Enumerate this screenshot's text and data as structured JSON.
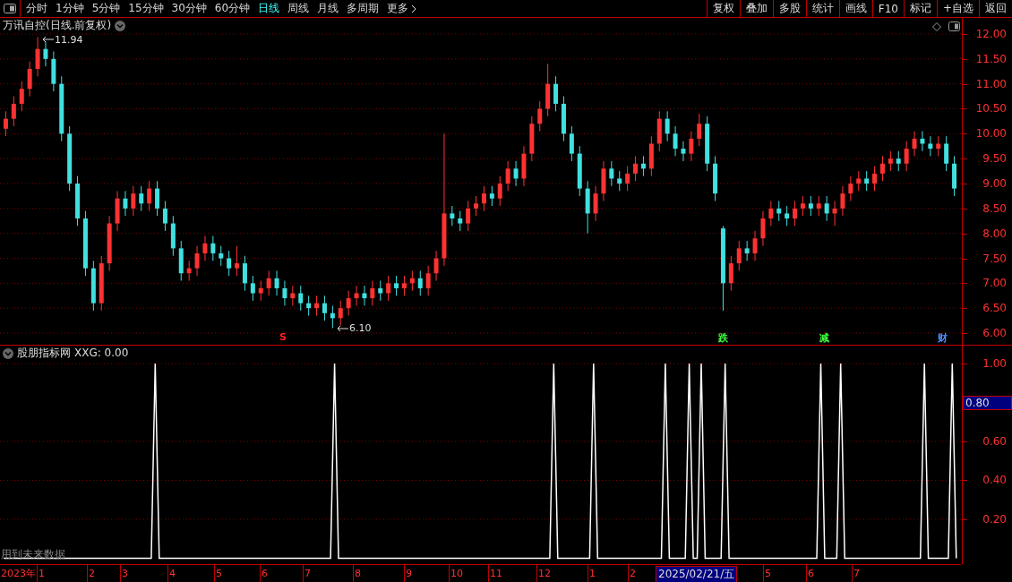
{
  "toolbar": {
    "periods": [
      {
        "label": "分时",
        "selected": false
      },
      {
        "label": "1分钟",
        "selected": false
      },
      {
        "label": "5分钟",
        "selected": false
      },
      {
        "label": "15分钟",
        "selected": false
      },
      {
        "label": "30分钟",
        "selected": false
      },
      {
        "label": "60分钟",
        "selected": false
      },
      {
        "label": "日线",
        "selected": true
      },
      {
        "label": "周线",
        "selected": false
      },
      {
        "label": "月线",
        "selected": false
      },
      {
        "label": "多周期",
        "selected": false
      },
      {
        "label": "更多",
        "selected": false
      }
    ],
    "buttons": [
      "复权",
      "叠加",
      "多股",
      "统计",
      "画线",
      "F10",
      "标记",
      "+自选",
      "返回"
    ]
  },
  "price_panel": {
    "title": "万讯自控(日线.前复权)",
    "annotations": [
      {
        "kind": "high",
        "text": "11.94"
      },
      {
        "kind": "low",
        "text": "6.10"
      }
    ],
    "markers": [
      {
        "text": "S",
        "color": "#ff2020"
      },
      {
        "text": "跌",
        "color": "#40ff40"
      },
      {
        "text": "减",
        "color": "#40ff40"
      },
      {
        "text": "财",
        "color": "#5090ff"
      }
    ],
    "chart_data": {
      "type": "candlestick",
      "ylim": [
        5.767,
        12.323
      ],
      "grid": true,
      "yticks": [
        {
          "value": 12,
          "label": "12.00"
        },
        {
          "value": 11.5,
          "label": "11.50"
        },
        {
          "value": 11,
          "label": "11.00"
        },
        {
          "value": 10.5,
          "label": "10.50"
        },
        {
          "value": 10,
          "label": "10.00"
        },
        {
          "value": 9.5,
          "label": "9.50"
        },
        {
          "value": 9,
          "label": "9.00"
        },
        {
          "value": 8.5,
          "label": "8.50"
        },
        {
          "value": 8,
          "label": "8.00"
        },
        {
          "value": 7.5,
          "label": "7.50"
        },
        {
          "value": 7,
          "label": "7.00"
        },
        {
          "value": 6.5,
          "label": "6.50"
        },
        {
          "value": 6,
          "label": "6.00"
        }
      ],
      "categories": [
        null,
        null,
        null,
        null,
        null,
        null,
        null,
        null,
        null,
        null,
        null,
        null,
        null,
        null,
        null,
        null,
        null,
        null,
        null,
        null,
        null,
        null,
        null,
        null,
        null,
        null,
        null,
        null,
        null,
        null,
        null,
        null,
        null,
        null,
        null,
        null,
        null,
        null,
        null,
        null,
        null,
        null,
        null,
        null,
        null,
        null,
        null,
        null,
        null,
        null,
        null,
        null,
        null,
        null,
        null,
        null,
        null,
        null,
        null,
        null,
        null,
        null,
        null,
        null,
        null,
        null,
        null,
        null,
        null,
        null,
        null,
        null,
        null,
        null,
        null,
        null,
        null,
        null,
        null,
        null,
        null,
        null,
        null,
        null,
        null,
        null,
        null,
        null,
        null,
        null,
        null,
        null,
        null,
        null,
        null,
        null,
        null,
        null,
        null,
        null,
        null,
        null,
        null,
        null,
        null,
        null,
        null,
        null,
        null,
        null,
        null,
        null,
        null,
        null,
        null,
        null,
        null,
        null,
        null,
        null
      ],
      "ohlc": [
        [
          10.1,
          10.45,
          9.95,
          10.3
        ],
        [
          10.3,
          10.75,
          10.15,
          10.6
        ],
        [
          10.6,
          11.05,
          10.45,
          10.9
        ],
        [
          10.9,
          11.45,
          10.75,
          11.3
        ],
        [
          11.3,
          11.94,
          11.15,
          11.7
        ],
        [
          11.7,
          11.85,
          11.35,
          11.5
        ],
        [
          11.5,
          11.65,
          10.85,
          11.0
        ],
        [
          11.0,
          11.15,
          9.85,
          10.0
        ],
        [
          10.0,
          10.15,
          8.85,
          9.0
        ],
        [
          9.0,
          9.15,
          8.15,
          8.3
        ],
        [
          8.3,
          8.45,
          7.15,
          7.3
        ],
        [
          7.3,
          7.45,
          6.45,
          6.6
        ],
        [
          6.6,
          7.55,
          6.45,
          7.4
        ],
        [
          7.4,
          8.35,
          7.25,
          8.2
        ],
        [
          8.2,
          8.85,
          8.05,
          8.7
        ],
        [
          8.7,
          8.85,
          8.35,
          8.5
        ],
        [
          8.5,
          8.95,
          8.35,
          8.8
        ],
        [
          8.8,
          8.95,
          8.45,
          8.6
        ],
        [
          8.6,
          9.05,
          8.45,
          8.9
        ],
        [
          8.9,
          9.05,
          8.35,
          8.5
        ],
        [
          8.5,
          8.65,
          8.05,
          8.2
        ],
        [
          8.2,
          8.35,
          7.55,
          7.7
        ],
        [
          7.7,
          7.85,
          7.05,
          7.2
        ],
        [
          7.2,
          7.45,
          7.05,
          7.3
        ],
        [
          7.3,
          7.75,
          7.15,
          7.6
        ],
        [
          7.6,
          7.95,
          7.45,
          7.8
        ],
        [
          7.8,
          7.95,
          7.45,
          7.6
        ],
        [
          7.6,
          7.75,
          7.35,
          7.5
        ],
        [
          7.5,
          7.65,
          7.15,
          7.3
        ],
        [
          7.3,
          7.75,
          7.15,
          7.4
        ],
        [
          7.4,
          7.55,
          6.85,
          7.0
        ],
        [
          7.0,
          7.15,
          6.65,
          6.8
        ],
        [
          6.8,
          7.05,
          6.65,
          6.9
        ],
        [
          6.9,
          7.25,
          6.75,
          7.1
        ],
        [
          7.1,
          7.25,
          6.75,
          6.9
        ],
        [
          6.9,
          7.05,
          6.55,
          6.7
        ],
        [
          6.7,
          6.95,
          6.55,
          6.8
        ],
        [
          6.8,
          6.95,
          6.45,
          6.6
        ],
        [
          6.6,
          6.75,
          6.35,
          6.5
        ],
        [
          6.5,
          6.75,
          6.35,
          6.6
        ],
        [
          6.6,
          6.75,
          6.25,
          6.4
        ],
        [
          6.4,
          6.55,
          6.1,
          6.3
        ],
        [
          6.3,
          6.65,
          6.15,
          6.5
        ],
        [
          6.5,
          6.85,
          6.35,
          6.7
        ],
        [
          6.7,
          6.95,
          6.55,
          6.8
        ],
        [
          6.8,
          6.95,
          6.55,
          6.7
        ],
        [
          6.7,
          7.05,
          6.55,
          6.9
        ],
        [
          6.9,
          7.05,
          6.65,
          6.8
        ],
        [
          6.8,
          7.15,
          6.65,
          7.0
        ],
        [
          7.0,
          7.15,
          6.75,
          6.9
        ],
        [
          6.9,
          7.15,
          6.75,
          7.0
        ],
        [
          7.0,
          7.25,
          6.85,
          7.1
        ],
        [
          7.1,
          7.25,
          6.75,
          6.9
        ],
        [
          6.9,
          7.35,
          6.75,
          7.2
        ],
        [
          7.2,
          7.65,
          7.05,
          7.5
        ],
        [
          7.5,
          10.0,
          7.35,
          8.4
        ],
        [
          8.4,
          8.55,
          8.15,
          8.3
        ],
        [
          8.3,
          8.45,
          8.05,
          8.2
        ],
        [
          8.2,
          8.65,
          8.05,
          8.5
        ],
        [
          8.5,
          8.75,
          8.35,
          8.6
        ],
        [
          8.6,
          8.95,
          8.45,
          8.8
        ],
        [
          8.8,
          8.95,
          8.55,
          8.7
        ],
        [
          8.7,
          9.15,
          8.55,
          9.0
        ],
        [
          9.0,
          9.45,
          8.85,
          9.3
        ],
        [
          9.3,
          9.45,
          8.95,
          9.1
        ],
        [
          9.1,
          9.75,
          8.95,
          9.6
        ],
        [
          9.6,
          10.35,
          9.45,
          10.2
        ],
        [
          10.2,
          10.65,
          10.05,
          10.5
        ],
        [
          10.5,
          11.4,
          10.35,
          11.0
        ],
        [
          11.0,
          11.15,
          10.45,
          10.6
        ],
        [
          10.6,
          10.75,
          9.85,
          10.0
        ],
        [
          10.0,
          10.15,
          9.45,
          9.6
        ],
        [
          9.6,
          9.75,
          8.75,
          8.9
        ],
        [
          8.9,
          9.05,
          8.0,
          8.4
        ],
        [
          8.4,
          8.95,
          8.25,
          8.8
        ],
        [
          8.8,
          9.45,
          8.65,
          9.3
        ],
        [
          9.3,
          9.45,
          8.95,
          9.1
        ],
        [
          9.1,
          9.25,
          8.85,
          9.0
        ],
        [
          9.0,
          9.35,
          8.85,
          9.2
        ],
        [
          9.2,
          9.55,
          9.05,
          9.4
        ],
        [
          9.4,
          9.55,
          9.15,
          9.3
        ],
        [
          9.3,
          9.95,
          9.15,
          9.8
        ],
        [
          9.8,
          10.45,
          9.65,
          10.3
        ],
        [
          10.3,
          10.45,
          9.85,
          10.0
        ],
        [
          10.0,
          10.15,
          9.55,
          9.7
        ],
        [
          9.7,
          9.85,
          9.45,
          9.6
        ],
        [
          9.6,
          10.05,
          9.45,
          9.9
        ],
        [
          9.9,
          10.4,
          9.75,
          10.2
        ],
        [
          10.2,
          10.35,
          9.25,
          9.4
        ],
        [
          9.4,
          9.55,
          8.65,
          8.8
        ],
        [
          8.1,
          8.15,
          6.45,
          7.0
        ],
        [
          7.0,
          7.55,
          6.85,
          7.4
        ],
        [
          7.4,
          7.85,
          7.25,
          7.7
        ],
        [
          7.7,
          7.85,
          7.45,
          7.6
        ],
        [
          7.6,
          8.05,
          7.45,
          7.9
        ],
        [
          7.9,
          8.45,
          7.75,
          8.3
        ],
        [
          8.3,
          8.65,
          8.15,
          8.5
        ],
        [
          8.5,
          8.65,
          8.25,
          8.4
        ],
        [
          8.4,
          8.55,
          8.15,
          8.3
        ],
        [
          8.3,
          8.65,
          8.15,
          8.5
        ],
        [
          8.5,
          8.75,
          8.35,
          8.6
        ],
        [
          8.6,
          8.75,
          8.35,
          8.5
        ],
        [
          8.5,
          8.75,
          8.35,
          8.6
        ],
        [
          8.6,
          8.75,
          8.25,
          8.4
        ],
        [
          8.4,
          8.65,
          8.15,
          8.5
        ],
        [
          8.5,
          8.95,
          8.35,
          8.8
        ],
        [
          8.8,
          9.15,
          8.65,
          9.0
        ],
        [
          9.0,
          9.25,
          8.85,
          9.1
        ],
        [
          9.1,
          9.25,
          8.85,
          9.0
        ],
        [
          9.0,
          9.35,
          8.85,
          9.2
        ],
        [
          9.2,
          9.55,
          9.05,
          9.4
        ],
        [
          9.4,
          9.65,
          9.25,
          9.5
        ],
        [
          9.5,
          9.65,
          9.25,
          9.4
        ],
        [
          9.4,
          9.85,
          9.25,
          9.7
        ],
        [
          9.7,
          10.05,
          9.55,
          9.9
        ],
        [
          9.9,
          10.05,
          9.65,
          9.8
        ],
        [
          9.8,
          9.95,
          9.55,
          9.7
        ],
        [
          9.7,
          9.95,
          9.55,
          9.8
        ],
        [
          9.8,
          9.95,
          9.25,
          9.4
        ],
        [
          9.4,
          9.55,
          8.75,
          8.9
        ]
      ]
    }
  },
  "indicator_panel": {
    "name": "股朋指标网",
    "reading": ": 0.00",
    "cursor_value": "0.80",
    "note": "用到未来数据",
    "chart_data": {
      "type": "line",
      "ylim": [
        -0.03,
        1.092
      ],
      "grid": true,
      "yticks": [
        {
          "value": 1,
          "label": "1.00"
        },
        {
          "value": 0.6,
          "label": "0.60"
        },
        {
          "value": 0.4,
          "label": "0.40"
        },
        {
          "value": 0.2,
          "label": "0.20"
        }
      ],
      "categories": [
        null,
        null,
        null,
        null,
        null,
        null,
        null,
        null,
        null,
        null,
        null,
        null,
        null,
        null,
        null,
        null,
        null,
        null,
        null,
        null,
        null,
        null,
        null,
        null,
        null,
        null,
        null,
        null,
        null,
        null,
        null,
        null,
        null,
        null,
        null,
        null,
        null,
        null,
        null,
        null,
        null,
        null,
        null,
        null,
        null,
        null,
        null,
        null,
        null,
        null,
        null,
        null,
        null,
        null,
        null,
        null,
        null,
        null,
        null,
        null,
        null,
        null,
        null,
        null,
        null,
        null,
        null,
        null,
        null,
        null,
        null,
        null,
        null,
        null,
        null,
        null,
        null,
        null,
        null,
        null,
        null,
        null,
        null,
        null,
        null,
        null,
        null,
        null,
        null,
        null,
        null,
        null,
        null,
        null,
        null,
        null,
        null,
        null,
        null,
        null,
        null,
        null,
        null,
        null,
        null,
        null,
        null,
        null,
        null,
        null,
        null,
        null,
        null,
        null,
        null,
        null,
        null,
        null,
        null,
        null,
        null,
        null,
        null,
        null,
        null,
        null,
        null,
        null,
        null,
        null,
        null,
        null,
        null,
        null,
        null,
        null,
        null,
        null,
        null,
        null,
        null,
        null,
        null,
        null,
        null,
        null,
        null,
        null,
        null,
        null,
        null,
        null,
        null,
        null,
        null,
        null,
        null,
        null,
        null,
        null,
        null,
        null,
        null,
        null,
        null,
        null,
        null,
        null,
        null,
        null,
        null,
        null,
        null,
        null,
        null,
        null,
        null,
        null,
        null,
        null,
        null,
        null,
        null,
        null,
        null,
        null,
        null,
        null,
        null,
        null,
        null,
        null,
        null,
        null,
        null,
        null,
        null,
        null,
        null,
        null,
        null,
        null,
        null,
        null,
        null,
        null,
        null,
        null,
        null,
        null,
        null,
        null,
        null,
        null,
        null,
        null,
        null,
        null,
        null,
        null,
        null,
        null,
        null,
        null,
        null,
        null,
        null,
        null,
        null,
        null,
        null,
        null,
        null,
        null,
        null,
        null,
        null,
        null,
        null,
        null
      ],
      "series": [
        {
          "name": "XXG",
          "color": "#ffffff",
          "values": [
            0,
            0,
            0,
            0,
            0,
            0,
            0,
            0,
            0,
            0,
            0,
            0,
            0,
            0,
            0,
            0,
            0,
            0,
            0,
            0,
            0,
            0,
            0,
            0,
            0,
            0,
            0,
            0,
            0,
            0,
            0,
            0,
            0,
            0,
            0,
            0,
            0,
            0,
            1,
            0,
            0,
            0,
            0,
            0,
            0,
            0,
            0,
            0,
            0,
            0,
            0,
            0,
            0,
            0,
            0,
            0,
            0,
            0,
            0,
            0,
            0,
            0,
            0,
            0,
            0,
            0,
            0,
            0,
            0,
            0,
            0,
            0,
            0,
            0,
            0,
            0,
            0,
            0,
            0,
            0,
            0,
            0,
            0,
            1,
            0,
            0,
            0,
            0,
            0,
            0,
            0,
            0,
            0,
            0,
            0,
            0,
            0,
            0,
            0,
            0,
            0,
            0,
            0,
            0,
            0,
            0,
            0,
            0,
            0,
            0,
            0,
            0,
            0,
            0,
            0,
            0,
            0,
            0,
            0,
            0,
            0,
            0,
            0,
            0,
            0,
            0,
            0,
            0,
            0,
            0,
            0,
            0,
            0,
            0,
            0,
            0,
            0,
            0,
            1,
            0,
            0,
            0,
            0,
            0,
            0,
            0,
            0,
            0,
            1,
            0,
            0,
            0,
            0,
            0,
            0,
            0,
            0,
            0,
            0,
            0,
            0,
            0,
            0,
            0,
            0,
            0,
            1,
            0,
            0,
            0,
            0,
            0,
            1,
            0,
            0,
            1,
            0,
            0,
            0,
            0,
            0,
            1,
            0,
            0,
            0,
            0,
            0,
            0,
            0,
            0,
            0,
            0,
            0,
            0,
            0,
            0,
            0,
            0,
            0,
            0,
            0,
            0,
            0,
            0,
            0,
            1,
            0,
            0,
            0,
            0,
            1,
            0,
            0,
            0,
            0,
            0,
            0,
            0,
            0,
            0,
            0,
            0,
            0,
            0,
            0,
            0,
            0,
            0,
            0,
            0,
            0,
            1,
            0,
            0,
            0,
            0,
            0,
            0,
            1,
            0
          ]
        }
      ]
    }
  },
  "time_axis": {
    "labels": [
      "2023年",
      "1",
      "2",
      "3",
      "4",
      "5",
      "6",
      "7",
      "8",
      "9",
      "10",
      "11",
      "12",
      "1",
      "2",
      "5",
      "6",
      "7"
    ],
    "cursor_date": "2025/02/21/五"
  }
}
